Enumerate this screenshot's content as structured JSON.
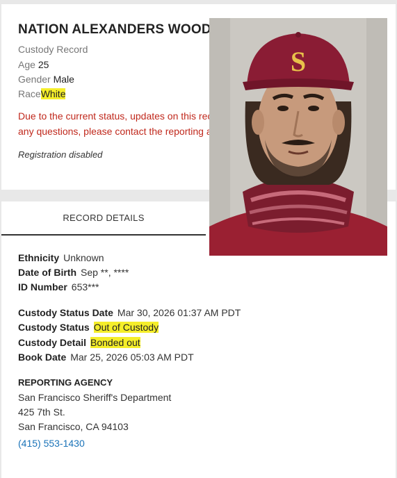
{
  "person": {
    "name": "NATION ALEXANDERS WOOD",
    "record_type": "Custody Record",
    "age_label": "Age",
    "age": "25",
    "gender_label": "Gender",
    "gender": "Male",
    "race_label": "Race",
    "race": "White",
    "status_message_line1": "Due to the current status, updates on this rec",
    "status_message_line2": "any questions, please contact the reporting a",
    "registration": "Registration disabled"
  },
  "tabs": [
    {
      "label": "RECORD DETAILS",
      "active": true
    }
  ],
  "details": {
    "ethnicity_label": "Ethnicity",
    "ethnicity": "Unknown",
    "dob_label": "Date of Birth",
    "dob": "Sep **, ****",
    "id_label": "ID Number",
    "id": "653***",
    "status_date_label": "Custody Status Date",
    "status_date": "Mar 30, 2026 01:37 AM PDT",
    "status_label": "Custody Status",
    "status": "Out of Custody",
    "detail_label": "Custody Detail",
    "detail": "Bonded out",
    "book_label": "Book Date",
    "book": "Mar 25, 2026 05:03 AM PDT"
  },
  "agency": {
    "heading": "REPORTING AGENCY",
    "name": "San Francisco Sheriff's Department",
    "street": "425 7th St.",
    "city": "San Francisco, CA 94103",
    "phone": "(415) 553-1430"
  },
  "photo": {
    "cap_letter": "S"
  },
  "colors": {
    "highlight": "#f5ee2a",
    "status_red": "#c0281c",
    "link_blue": "#1a73b8",
    "cap_maroon": "#8a1c34"
  }
}
